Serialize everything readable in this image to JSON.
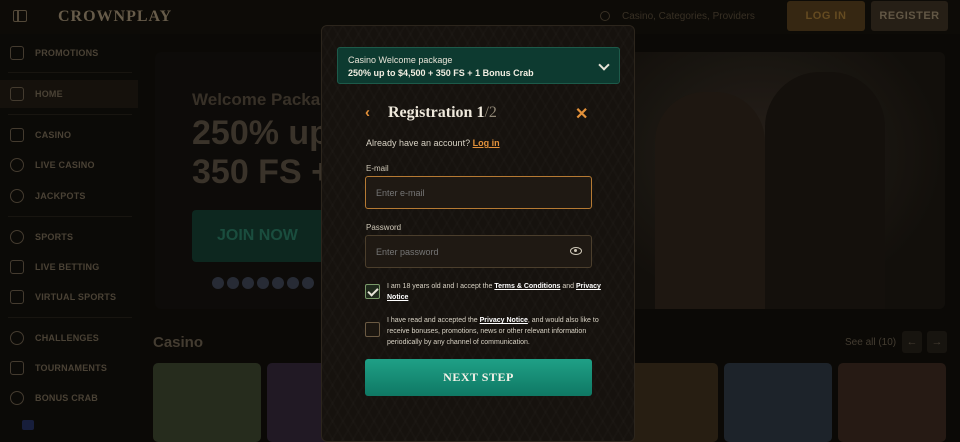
{
  "header": {
    "logo": "CROWNPLAY",
    "search_placeholder": "Casino, Categories, Providers",
    "login_label": "LOG IN",
    "register_label": "REGISTER"
  },
  "sidebar": {
    "items": [
      {
        "label": "PROMOTIONS",
        "icon": "gift-icon"
      },
      {
        "label": "HOME",
        "icon": "home-icon"
      },
      {
        "label": "CASINO",
        "icon": "casino-icon"
      },
      {
        "label": "LIVE CASINO",
        "icon": "spade-icon"
      },
      {
        "label": "JACKPOTS",
        "icon": "jackpot-icon"
      },
      {
        "label": "SPORTS",
        "icon": "ball-icon"
      },
      {
        "label": "LIVE BETTING",
        "icon": "live-icon"
      },
      {
        "label": "VIRTUAL SPORTS",
        "icon": "gamepad-icon"
      },
      {
        "label": "CHALLENGES",
        "icon": "trophy-icon"
      },
      {
        "label": "TOURNAMENTS",
        "icon": "cup-icon"
      },
      {
        "label": "BONUS CRAB",
        "icon": "crab-icon"
      }
    ]
  },
  "hero": {
    "title": "Welcome Package",
    "line1": "250% up",
    "line2": "350 FS +",
    "cta": "JOIN NOW"
  },
  "casino": {
    "title": "Casino",
    "see_all": "See all (10)"
  },
  "modal": {
    "promo_line1": "Casino Welcome package",
    "promo_line2": "250% up to $4,500 + 350 FS + 1 Bonus Crab",
    "title": "Registration",
    "step": "1",
    "total": "/2",
    "have_account": "Already have an account?",
    "login_link": "Log in",
    "email_label": "E-mail",
    "email_placeholder": "Enter e-mail",
    "password_label": "Password",
    "password_placeholder": "Enter password",
    "terms_pre": "I am 18 years old and I accept the",
    "terms_link": "Terms & Conditions",
    "terms_and": "and",
    "privacy_link": "Privacy Notice",
    "terms_checked": true,
    "marketing_pre": "I have read and accepted the",
    "marketing_link": "Privacy Notice",
    "marketing_post": ", and would also like to receive bonuses, promotions, news or other relevant information periodically by any channel of communication.",
    "marketing_checked": false,
    "next_label": "NEXT STEP"
  },
  "colors": {
    "accent": "#e3913a",
    "promo_bg": "#0d3a30",
    "next_btn": "#1fa086"
  }
}
